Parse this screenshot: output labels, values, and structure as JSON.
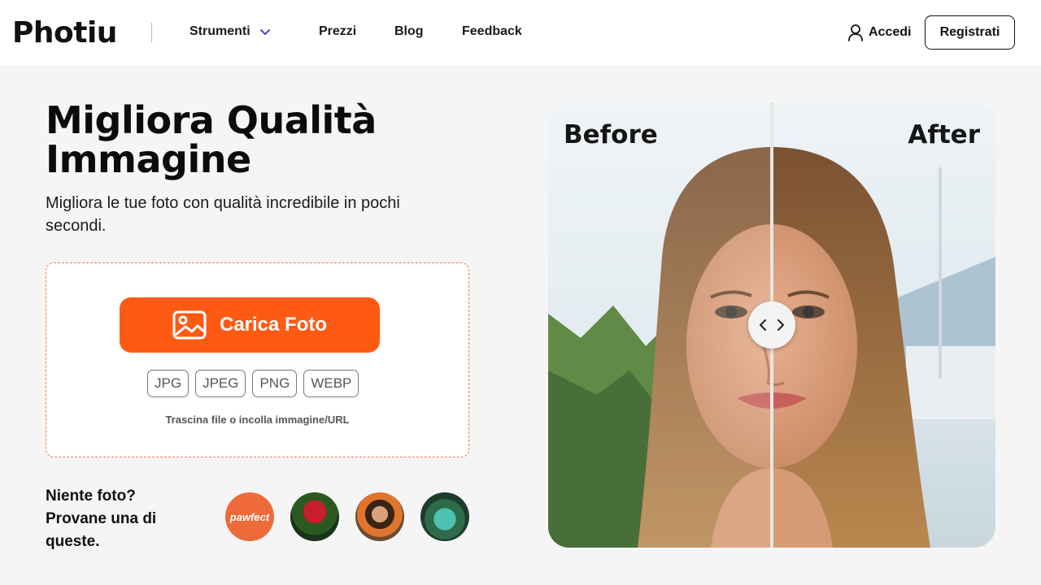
{
  "header": {
    "logo": "Photiu",
    "nav": {
      "tools": "Strumenti",
      "prices": "Prezzi",
      "blog": "Blog",
      "feedback": "Feedback"
    },
    "login": "Accedi",
    "register": "Registrati"
  },
  "hero": {
    "title": "Migliora Qualità Immagine",
    "subtitle": "Migliora le tue foto con qualità incredibile in pochi secondi."
  },
  "upload": {
    "button_label": "Carica Foto",
    "formats": [
      "JPG",
      "JPEG",
      "PNG",
      "WEBP"
    ],
    "hint": "Trascina file o incolla immagine/URL"
  },
  "samples": {
    "prompt": "Niente foto? Provane una di queste.",
    "items": [
      {
        "icon": "pawfect-logo",
        "text": "pawfect"
      },
      {
        "icon": "tulips-image"
      },
      {
        "icon": "woman-portrait-image"
      },
      {
        "icon": "lake-landscape-image"
      }
    ]
  },
  "comparison": {
    "before_label": "Before",
    "after_label": "After"
  },
  "colors": {
    "accent": "#ff5a13",
    "dashed_border": "#f07a4a",
    "background": "#f5f5f6"
  }
}
